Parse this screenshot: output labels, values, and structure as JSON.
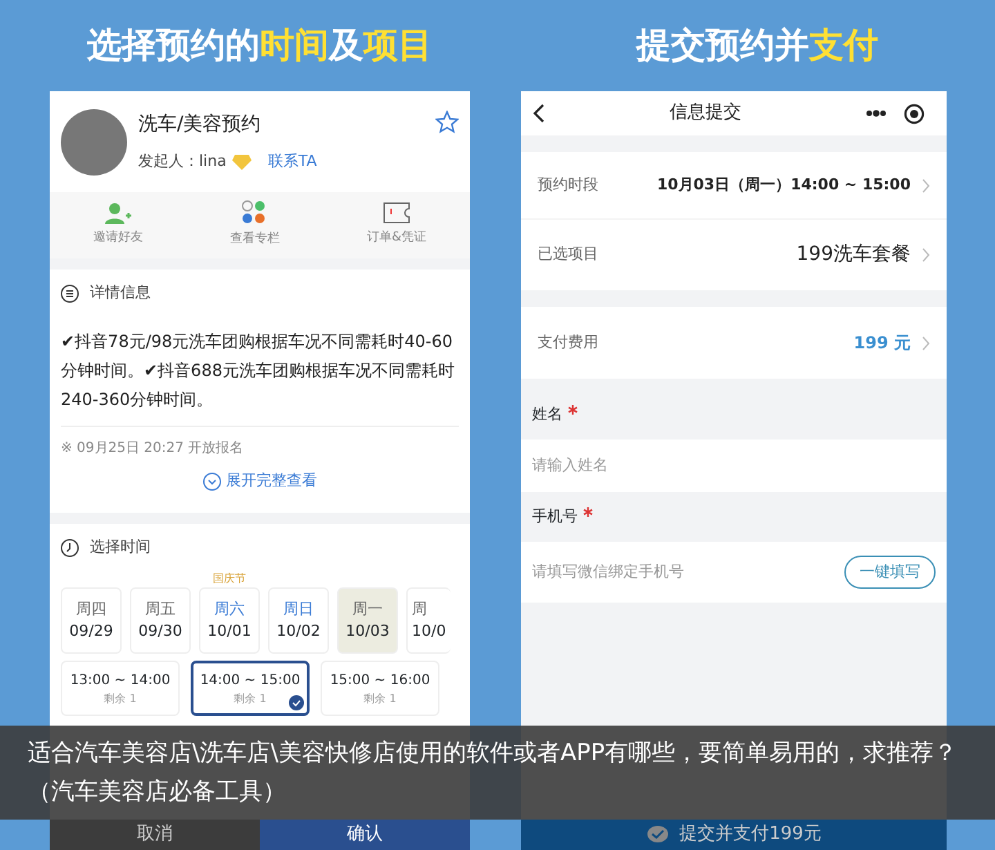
{
  "headings": [
    {
      "parts": [
        {
          "text": "选择预约的",
          "highlight": false
        },
        {
          "text": "时间",
          "highlight": true
        },
        {
          "text": "及",
          "highlight": false
        },
        {
          "text": "项目",
          "highlight": true
        }
      ]
    },
    {
      "parts": [
        {
          "text": "提交预约并",
          "highlight": false
        },
        {
          "text": "支付",
          "highlight": true
        }
      ]
    }
  ],
  "left_screen": {
    "title": "洗车/美容预约",
    "organizer": "发起人：lina",
    "contact": "联系TA",
    "actions": [
      {
        "label": "邀请好友",
        "kind": "invite"
      },
      {
        "label": "查看专栏",
        "kind": "column"
      },
      {
        "label": "订单&凭证",
        "kind": "ticket"
      }
    ],
    "details_title": "详情信息",
    "details_text": "✔抖音78元/98元洗车团购根据车况不同需耗时40-60分钟时间。✔抖音688元洗车团购根据车况不同需耗时240-360分钟时间。",
    "open_time": "※ 09月25日 20:27 开放报名",
    "expand": "展开完整查看",
    "time_title": "选择时间",
    "dates": [
      {
        "weekday": "周四",
        "date": "09/29",
        "weekend": false,
        "selected": false
      },
      {
        "weekday": "周五",
        "date": "09/30",
        "weekend": false,
        "selected": false
      },
      {
        "weekday": "周六",
        "date": "10/01",
        "weekend": true,
        "holiday": "国庆节",
        "selected": false
      },
      {
        "weekday": "周日",
        "date": "10/02",
        "weekend": true,
        "selected": false
      },
      {
        "weekday": "周一",
        "date": "10/03",
        "weekend": false,
        "selected": true
      },
      {
        "weekday": "周",
        "date": "10/0",
        "weekend": false,
        "selected": false
      }
    ],
    "slots": [
      {
        "time": "13:00 ~ 14:00",
        "remaining": "剩余 1",
        "selected": false
      },
      {
        "time": "14:00 ~ 15:00",
        "remaining": "剩余 1",
        "selected": true
      },
      {
        "time": "15:00 ~ 16:00",
        "remaining": "剩余 1",
        "selected": false
      }
    ],
    "buttons": [
      "取消",
      "确认"
    ]
  },
  "right_screen": {
    "title": "信息提交",
    "rows": [
      {
        "label": "预约时段",
        "value": "10月03日（周一）14:00 ~ 15:00",
        "kind": "bold"
      },
      {
        "label": "已选项目",
        "value": "199洗车套餐",
        "kind": "large"
      },
      {
        "label": "支付费用",
        "value": "199 元",
        "kind": "price"
      }
    ],
    "fields": [
      {
        "label": "姓名",
        "required": true,
        "placeholder": "请输入姓名"
      },
      {
        "label": "手机号",
        "required": true,
        "placeholder": "请填写微信绑定手机号",
        "button": "一键填写"
      }
    ],
    "submit": "提交并支付199元"
  },
  "caption": "适合汽车美容店\\洗车店\\美容快修店使用的软件或者APP有哪些，要简单易用的，求推荐？（汽车美容店必备工具）"
}
